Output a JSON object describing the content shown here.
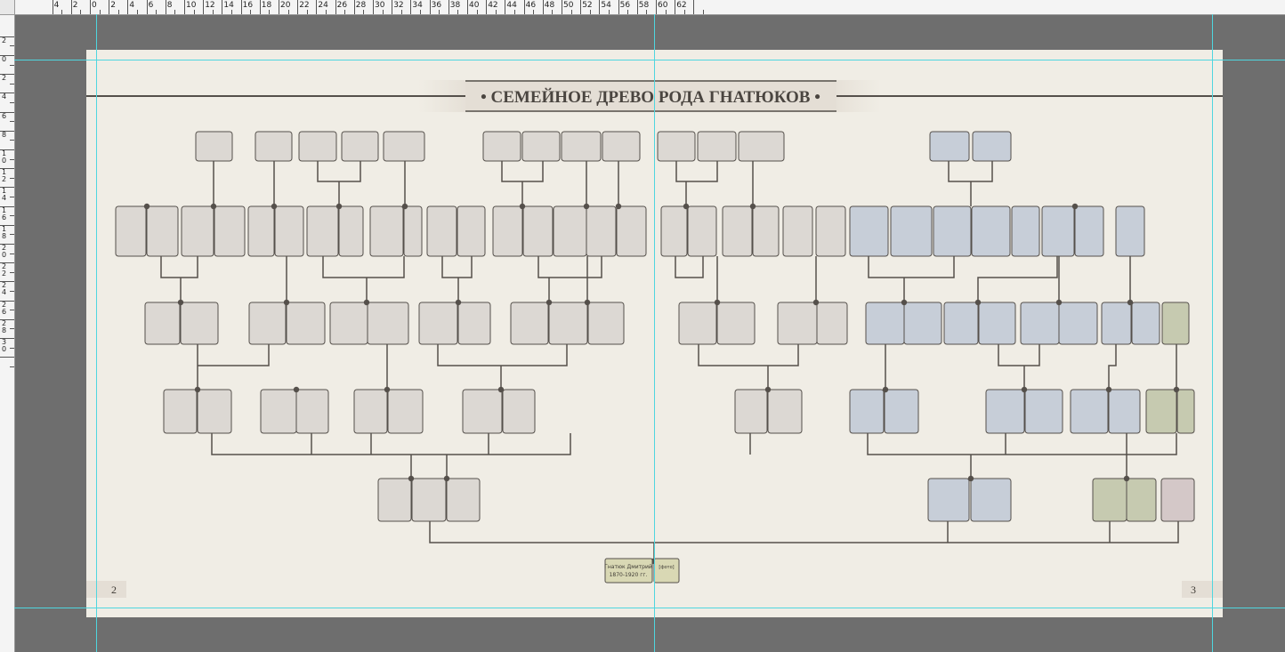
{
  "title": "• СЕМЕЙНОЕ ДРЕВО РОДА ГНАТЮКОВ •",
  "page_left": "2",
  "page_right": "3",
  "root_person": {
    "name": "Гнатюк Дмитрий",
    "dates": "1870-1920 гг.",
    "tag": "[фото]"
  },
  "ruler_top_labels": [
    "4",
    "2",
    "0",
    "2",
    "4",
    "6",
    "8",
    "10",
    "12",
    "14",
    "16",
    "18",
    "20",
    "22",
    "24",
    "26",
    "28",
    "30",
    "32",
    "34",
    "36",
    "38",
    "40",
    "42",
    "44",
    "46",
    "48",
    "50",
    "52",
    "54",
    "56",
    "58",
    "60",
    "62"
  ],
  "ruler_left_labels": [
    "2",
    "0",
    "2",
    "4",
    "6",
    "8",
    "10",
    "12",
    "14",
    "16",
    "18",
    "20",
    "22",
    "24",
    "26",
    "28",
    "30"
  ],
  "colors": {
    "workspace": "#6e6e6e",
    "paper": "#f0ede5",
    "box_grey": "#dcd8d3",
    "box_blue": "#c7ced8",
    "box_green": "#c6cab0",
    "box_pink": "#d4c8c8",
    "box_root": "#d9d8b4",
    "line": "#55504b",
    "guide": "#4fd6df"
  }
}
